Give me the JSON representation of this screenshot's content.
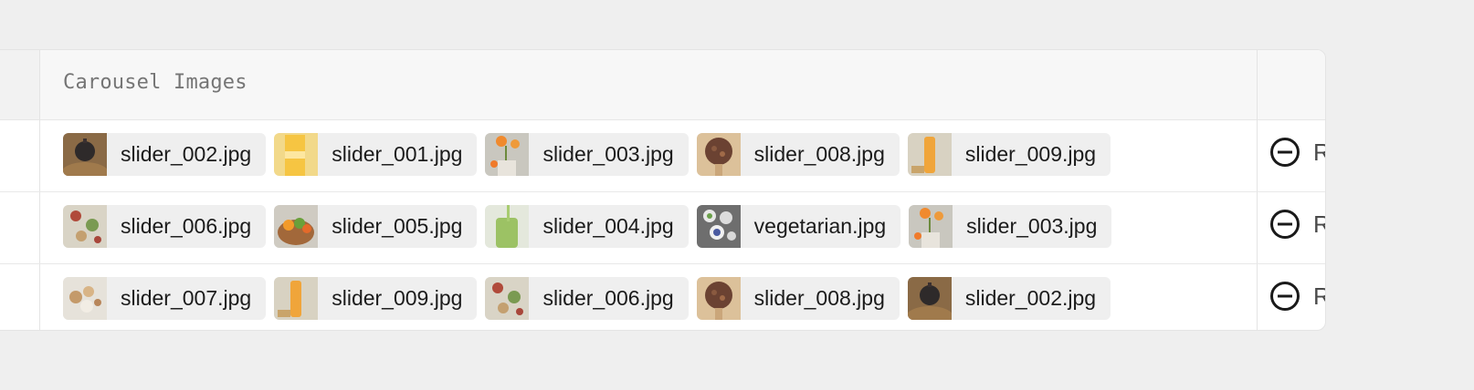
{
  "table": {
    "column_title": "Carousel Images",
    "remove_label": "Remove",
    "rows": [
      {
        "images": [
          {
            "filename": "slider_002.jpg",
            "thumb": "dark-fig-on-wood"
          },
          {
            "filename": "slider_001.jpg",
            "thumb": "yellow-juice-bottle"
          },
          {
            "filename": "slider_003.jpg",
            "thumb": "orange-flowers"
          },
          {
            "filename": "slider_008.jpg",
            "thumb": "nut-bowl"
          },
          {
            "filename": "slider_009.jpg",
            "thumb": "juice-bottle"
          }
        ]
      },
      {
        "images": [
          {
            "filename": "slider_006.jpg",
            "thumb": "salad-figs"
          },
          {
            "filename": "slider_005.jpg",
            "thumb": "fruit-basket"
          },
          {
            "filename": "slider_004.jpg",
            "thumb": "green-smoothie"
          },
          {
            "filename": "vegetarian.jpg",
            "thumb": "vegetable-bowls"
          },
          {
            "filename": "slider_003.jpg",
            "thumb": "orange-flowers"
          }
        ]
      },
      {
        "images": [
          {
            "filename": "slider_007.jpg",
            "thumb": "nuts-on-white"
          },
          {
            "filename": "slider_009.jpg",
            "thumb": "juice-bottle"
          },
          {
            "filename": "slider_006.jpg",
            "thumb": "salad-figs"
          },
          {
            "filename": "slider_008.jpg",
            "thumb": "nut-bowl"
          },
          {
            "filename": "slider_002.jpg",
            "thumb": "dark-fig-on-wood"
          }
        ]
      }
    ]
  }
}
